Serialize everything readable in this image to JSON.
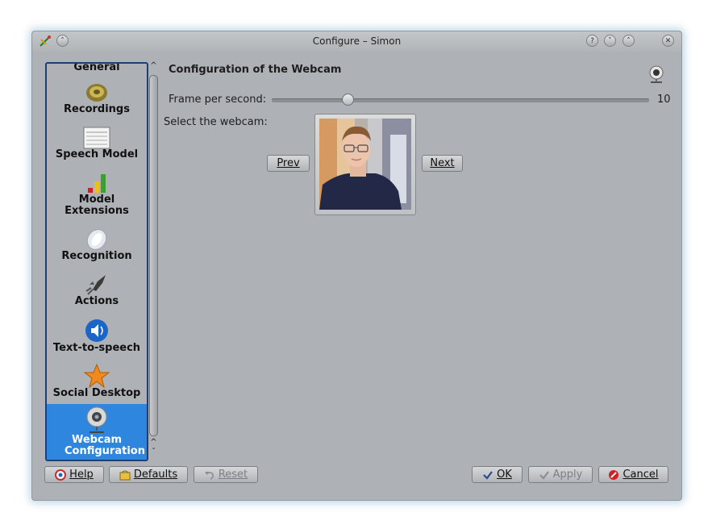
{
  "window": {
    "title": "Configure – Simon"
  },
  "titlebar": {
    "help": "?",
    "minimize": "˅",
    "maximize": "˄",
    "close": "✕",
    "shade": "˄"
  },
  "sidebar": {
    "items": [
      {
        "label": "General",
        "icon": "general-icon"
      },
      {
        "label": "Recordings",
        "icon": "speaker-icon"
      },
      {
        "label": "Speech Model",
        "icon": "document-icon"
      },
      {
        "label": "Model Extensions",
        "icon": "bar-graph-icon"
      },
      {
        "label": "Recognition",
        "icon": "recognition-icon"
      },
      {
        "label": "Actions",
        "icon": "rocket-icon"
      },
      {
        "label": "Text-to-speech",
        "icon": "audio-icon"
      },
      {
        "label": "Social Desktop",
        "icon": "star-icon"
      },
      {
        "label": "Webcam Configuration",
        "icon": "webcam-icon",
        "active": true
      }
    ],
    "scroll_up": "^",
    "scroll_down": "ˇ"
  },
  "main": {
    "title": "Configuration of the Webcam",
    "fps_label": "Frame per second:",
    "fps_value": "10",
    "fps_fraction": 0.21,
    "select_label": "Select the webcam:",
    "prev_label": "Prev",
    "next_label": "Next"
  },
  "footer": {
    "help": "Help",
    "defaults": "Defaults",
    "reset": "Reset",
    "ok": "OK",
    "apply": "Apply",
    "cancel": "Cancel"
  },
  "colors": {
    "accent": "#2e86de",
    "sidebar_border": "#1d3f74",
    "window_bg": "#aeb1b5"
  }
}
